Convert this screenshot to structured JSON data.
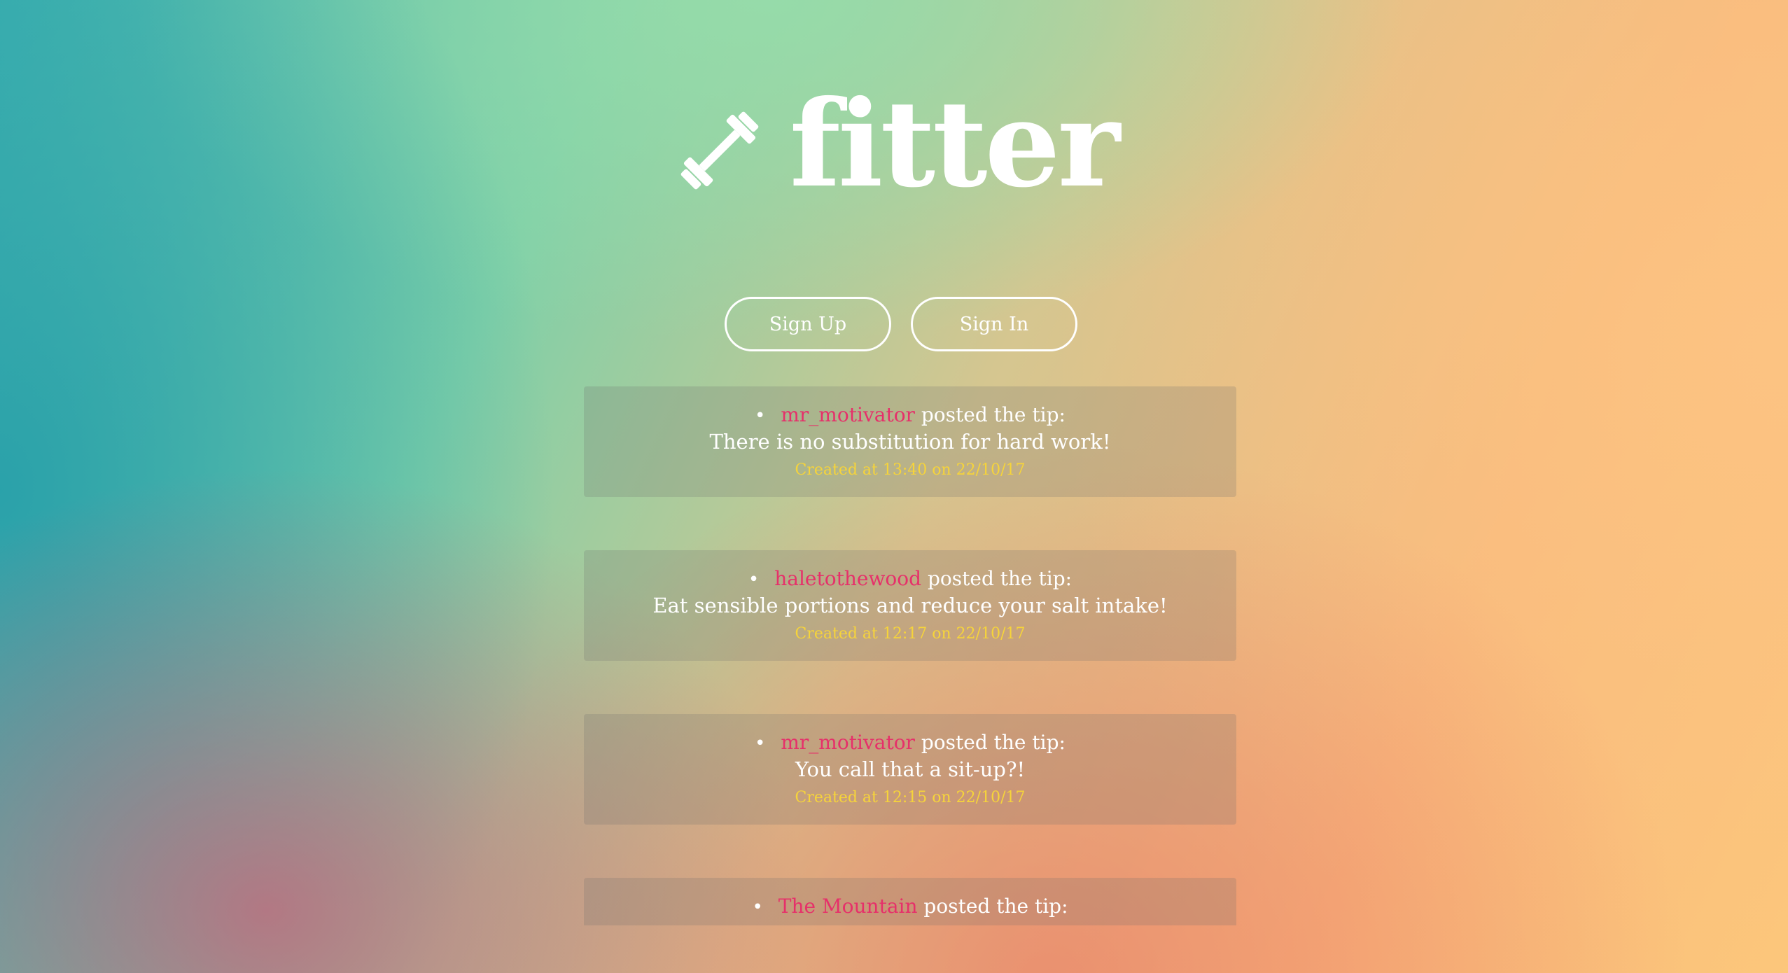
{
  "brand": {
    "name": "fitter",
    "icon": "dumbbell-icon"
  },
  "auth": {
    "sign_up_label": "Sign Up",
    "sign_in_label": "Sign In"
  },
  "tips": [
    {
      "username": "mr_motivator",
      "action": "posted the tip:",
      "text": "There is no substitution for hard work!",
      "created": "Created at 13:40 on 22/10/17"
    },
    {
      "username": "haletothewood",
      "action": "posted the tip:",
      "text": "Eat sensible portions and reduce your salt intake!",
      "created": "Created at 12:17 on 22/10/17"
    },
    {
      "username": "mr_motivator",
      "action": "posted the tip:",
      "text": "You call that a sit-up?!",
      "created": "Created at 12:15 on 22/10/17"
    },
    {
      "username": "The Mountain",
      "action": "posted the tip:",
      "text": "",
      "created": ""
    }
  ],
  "colors": {
    "username": "#e6306a",
    "timestamp": "#f6d43a",
    "text": "#ffffff"
  }
}
